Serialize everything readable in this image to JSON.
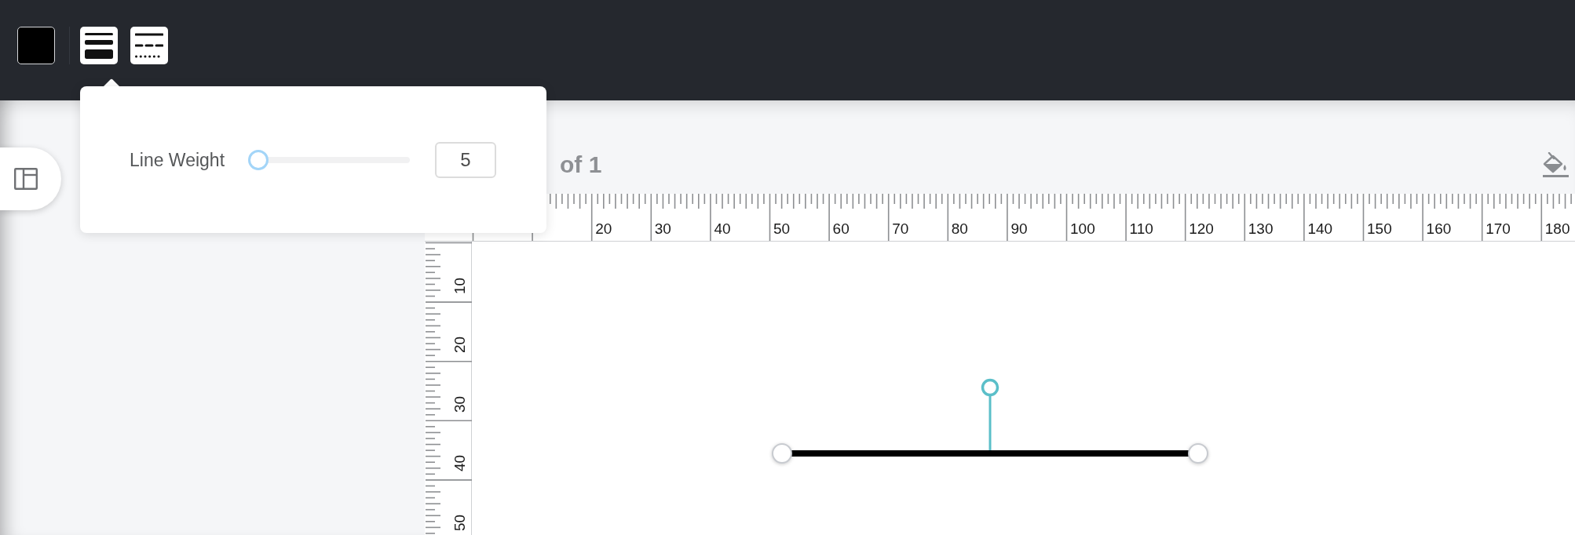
{
  "toolbar": {
    "buttons": [
      {
        "kind": "line-weight"
      },
      {
        "kind": "line-style"
      }
    ]
  },
  "popover": {
    "label": "Line Weight",
    "slider": {
      "level": 0
    },
    "value": "5"
  },
  "page_indicator": "of 1",
  "rulers": {
    "horizontal": [
      "20",
      "30",
      "40",
      "50",
      "60",
      "70",
      "80",
      "90",
      "100",
      "110",
      "120",
      "130",
      "140",
      "150",
      "160",
      "170",
      "180"
    ],
    "vertical": [
      "10",
      "20",
      "30",
      "40",
      "50"
    ]
  },
  "canvas": {
    "shapes": [
      {
        "kind": "line",
        "selected": true
      }
    ]
  }
}
